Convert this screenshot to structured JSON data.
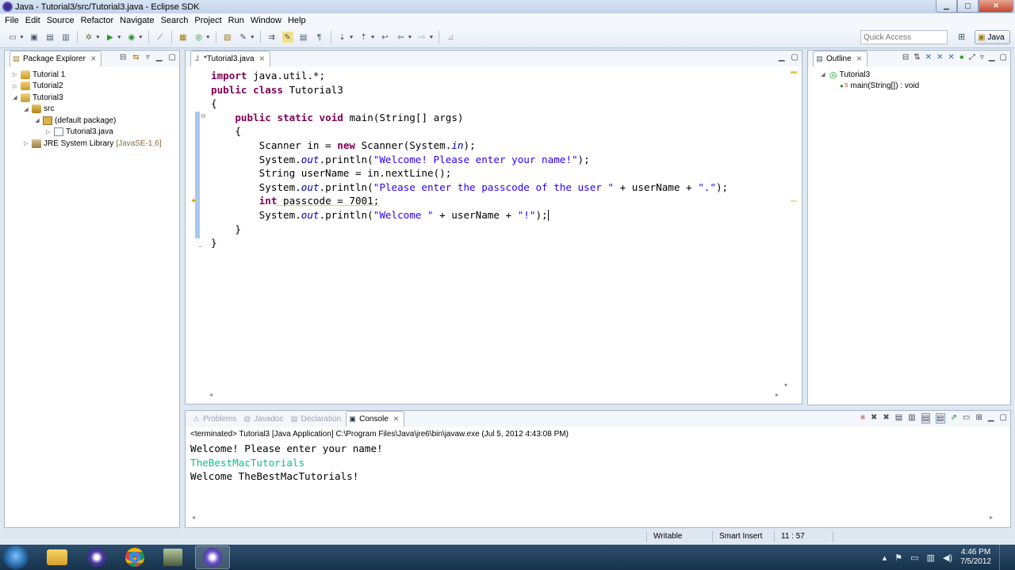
{
  "window": {
    "title": "Java - Tutorial3/src/Tutorial3.java - Eclipse SDK"
  },
  "menu": [
    "File",
    "Edit",
    "Source",
    "Refactor",
    "Navigate",
    "Search",
    "Project",
    "Run",
    "Window",
    "Help"
  ],
  "toolbar": {
    "quick_access_placeholder": "Quick Access",
    "perspective": "Java"
  },
  "package_explorer": {
    "tab_label": "Package Explorer",
    "tree": [
      {
        "label": "Tutorial 1",
        "level": 0,
        "twisty": "▷",
        "icon": "project"
      },
      {
        "label": "Tutorial2",
        "level": 0,
        "twisty": "▷",
        "icon": "project"
      },
      {
        "label": "Tutorial3",
        "level": 0,
        "twisty": "◢",
        "icon": "project"
      },
      {
        "label": "src",
        "level": 1,
        "twisty": "◢",
        "icon": "src"
      },
      {
        "label": "(default package)",
        "level": 2,
        "twisty": "◢",
        "icon": "package"
      },
      {
        "label": "Tutorial3.java",
        "level": 3,
        "twisty": "▷",
        "icon": "java"
      },
      {
        "label": "JRE System Library",
        "suffix": "[JavaSE-1.6]",
        "level": 1,
        "twisty": "▷",
        "icon": "jar"
      }
    ]
  },
  "editor": {
    "tab_label": "*Tutorial3.java",
    "code": {
      "l1_kw": "import",
      "l1_rest": " java.util.*;",
      "l2_kw1": "public",
      "l2_kw2": "class",
      "l2_rest": " Tutorial3",
      "l3": "{",
      "l4_kw1": "public",
      "l4_kw2": "static",
      "l4_kw3": "void",
      "l4_rest": " main(String[] args)",
      "l5": "    {",
      "l6_a": "        Scanner in = ",
      "l6_kw": "new",
      "l6_b": " Scanner(System.",
      "l6_it": "in",
      "l6_c": ");",
      "l7_a": "        System.",
      "l7_it": "out",
      "l7_b": ".println(",
      "l7_str": "\"Welcome! Please enter your name!\"",
      "l7_c": ");",
      "l8": "        String userName = in.nextLine();",
      "l9_a": "        System.",
      "l9_it": "out",
      "l9_b": ".println(",
      "l9_str1": "\"Please enter the passcode of the user \"",
      "l9_c": " + userName + ",
      "l9_str2": "\".\"",
      "l9_d": ");",
      "l10_kw": "int",
      "l10_rest": " passcode = 7001;",
      "l11_a": "        System.",
      "l11_it": "out",
      "l11_b": ".println(",
      "l11_str1": "\"Welcome \"",
      "l11_c": " + userName + ",
      "l11_str2": "\"!\"",
      "l11_d": ");",
      "l12": "    }",
      "l13": "}"
    }
  },
  "outline": {
    "tab_label": "Outline",
    "class_name": "Tutorial3",
    "method": "main(String[]) : void"
  },
  "bottom_tabs": [
    "Problems",
    "Javadoc",
    "Declaration",
    "Console"
  ],
  "console": {
    "header": "<terminated> Tutorial3 [Java Application] C:\\Program Files\\Java\\jre6\\bin\\javaw.exe (Jul 5, 2012 4:43:08 PM)",
    "line1": "Welcome! Please enter your name!",
    "input_line": "TheBestMacTutorials",
    "line3": "Welcome TheBestMacTutorials!"
  },
  "status": {
    "writable": "Writable",
    "insert_mode": "Smart Insert",
    "position": "11 : 57"
  },
  "clock": {
    "time": "4:46 PM",
    "date": "7/5/2012"
  },
  "colors": {
    "keyword": "#7f0055",
    "string": "#2a00ff",
    "field": "#0000c0",
    "stdin": "#00c87d"
  }
}
